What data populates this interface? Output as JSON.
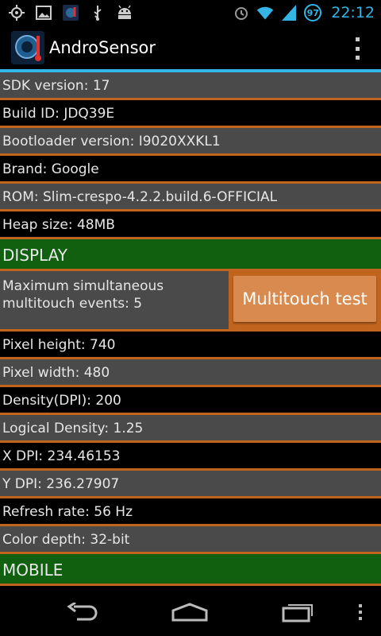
{
  "status_bar": {
    "left_icons": [
      "gps-icon",
      "image-icon",
      "app-notification-icon",
      "usb-icon",
      "android-debug-icon"
    ],
    "right_icons": [
      "alarm-icon",
      "wifi-icon",
      "signal-icon"
    ],
    "battery": "97",
    "time": "22:12"
  },
  "app": {
    "title": "AndroSensor"
  },
  "rows": [
    "SDK version: 17",
    "Build ID: JDQ39E",
    "Bootloader version: I9020XXKL1",
    "Brand: Google",
    "ROM: Slim-crespo-4.2.2.build.6-OFFICIAL",
    "Heap size: 48MB"
  ],
  "display_section": {
    "title": "DISPLAY",
    "multitouch_text": "Maximum simultaneous multitouch events: 5",
    "multitouch_button": "Multitouch test",
    "rows": [
      "Pixel height: 740",
      "Pixel width: 480",
      "Density(DPI): 200",
      "Logical Density: 1.25",
      "X DPI: 234.46153",
      "Y DPI: 236.27907",
      "Refresh rate: 56 Hz",
      "Color depth: 32-bit"
    ]
  },
  "mobile_section": {
    "title": "MOBILE"
  },
  "colors": {
    "accent_blue": "#33b5e5",
    "row_gray": "#4a4a4a",
    "divider_orange": "#c0641e",
    "section_green": "#106010",
    "button_orange": "#d98a4e"
  }
}
